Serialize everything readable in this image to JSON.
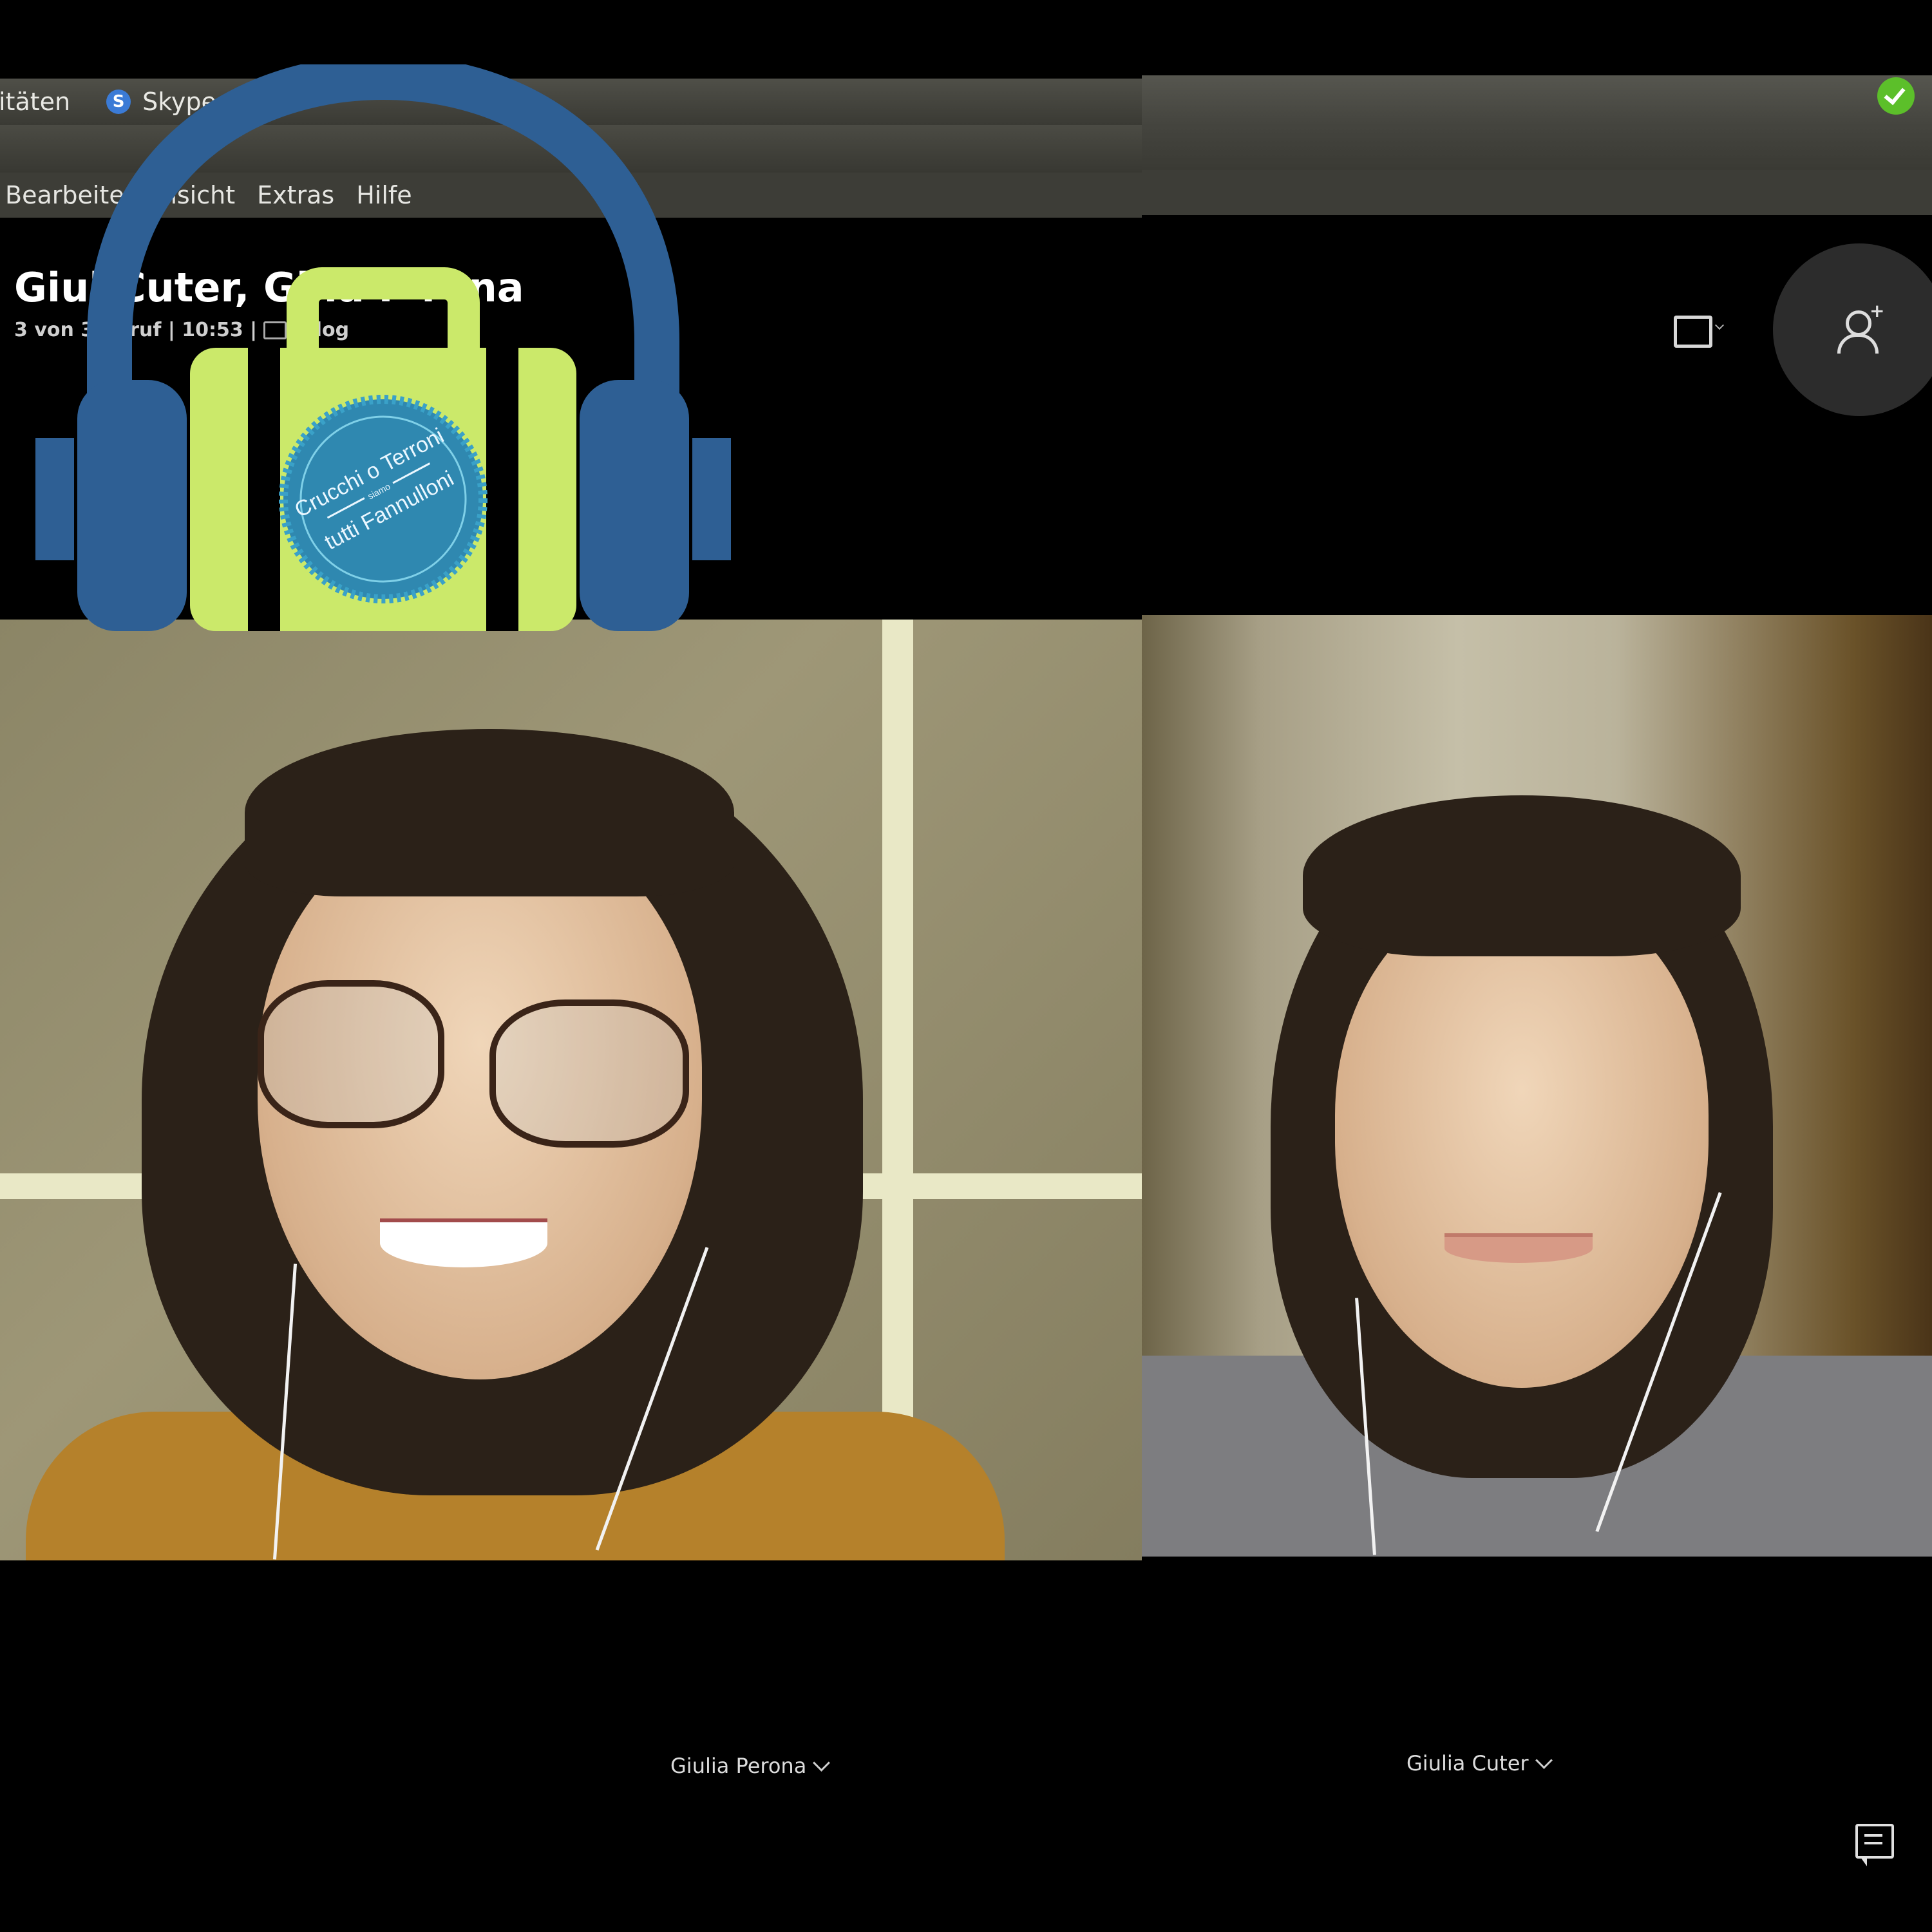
{
  "topbar": {
    "activities_label": "itäten",
    "app_label": "Skype",
    "app_badge": "S"
  },
  "menu": {
    "items": [
      "Bearbeiten",
      "nsicht",
      "Extras",
      "Hilfe"
    ]
  },
  "conversation": {
    "title": "Giul  Cuter, Gi   ia P    rona",
    "meta": "3 von 3   Anruf | 10:53 |",
    "meta_suffix": "talog"
  },
  "participants": [
    {
      "name": "Giulia Perona"
    },
    {
      "name": "Giulia Cuter"
    }
  ],
  "logo": {
    "text_top": "Crucchi o Terroni",
    "text_middle": "siamo",
    "text_bottom": "tutti Fannulloni",
    "colors": {
      "headphones": "#2e5f94",
      "suitcase": "#cbe96a",
      "seal": "#3a8fb5"
    }
  },
  "icons": {
    "status": "check-circle-icon",
    "screen": "screen-share-icon",
    "add_person": "add-person-icon",
    "chat": "chat-icon"
  }
}
